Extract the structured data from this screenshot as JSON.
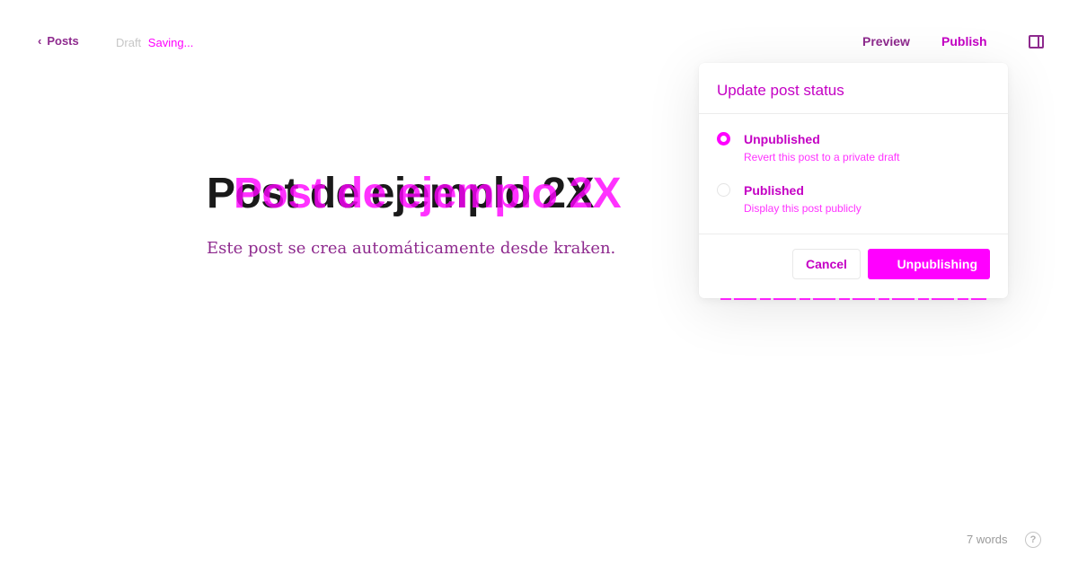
{
  "header": {
    "back_label": "Posts",
    "status_primary": "Draft",
    "status_secondary": "Saving...",
    "preview_label": "Preview",
    "publish_label": "Publish",
    "sidebar_toggle_icon": "sidebar-icon"
  },
  "editor": {
    "title": "Post de ejemplo 2X",
    "excerpt": "Este post se crea automáticamente desde kraken."
  },
  "footer": {
    "word_count": "7 words",
    "help_label": "?"
  },
  "publish_menu": {
    "title": "Update post status",
    "options": [
      {
        "label": "Unpublished",
        "description": "Revert this post to a private draft",
        "selected": true
      },
      {
        "label": "Published",
        "description": "Display this post publicly",
        "selected": false
      }
    ],
    "cancel_label": "Cancel",
    "confirm_label": "Unpublishing"
  },
  "colors": {
    "accent": "#ff00ff",
    "accent_text": "#c400c4",
    "muted": "#8e2a8e"
  }
}
